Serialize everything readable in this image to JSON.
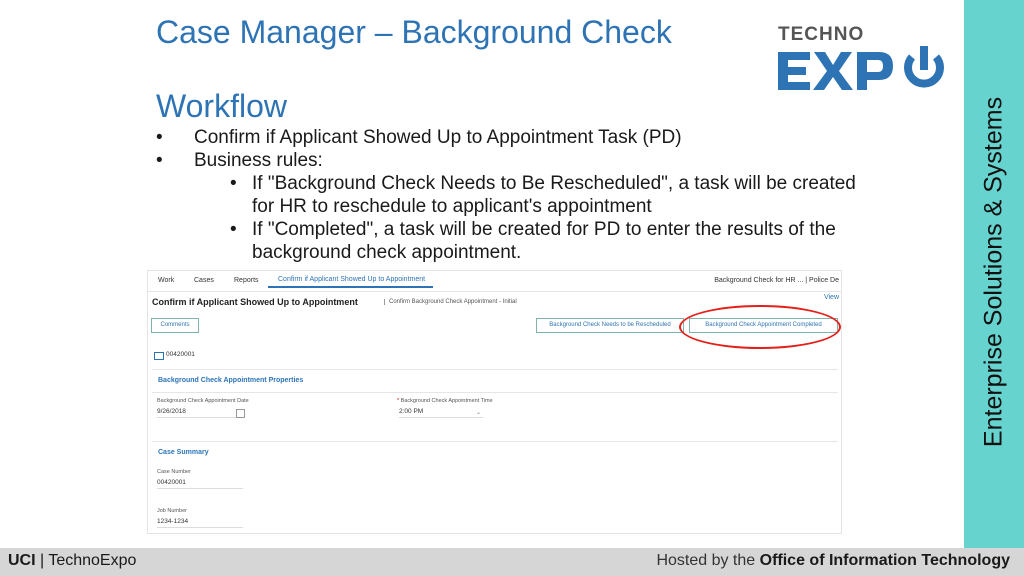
{
  "slide": {
    "title": "Case Manager – Background Check",
    "section_title": "Workflow",
    "bullet_1": "Confirm if Applicant Showed Up to Appointment Task (PD)",
    "bullet_2": "Business rules:",
    "sub_bullet_1": "If \"Background Check Needs to Be Rescheduled\", a task will be created for HR to reschedule to applicant's appointment",
    "sub_bullet_2": "If \"Completed\", a task will be created for PD to enter the results of the background check appointment.",
    "bullet_char": "•"
  },
  "logo": {
    "top": "TECHNO",
    "bottom": "EXPO"
  },
  "sidebar_text": "Enterprise Solutions & Systems",
  "footer": {
    "left_bold": "UCI",
    "left_sep": "|",
    "left_text": "TechnoExpo",
    "right_text": "Hosted by the",
    "right_bold": "Office of Information Technology"
  },
  "app": {
    "nav": {
      "work": "Work",
      "cases": "Cases",
      "reports": "Reports",
      "active_tab": "Confirm if Applicant Showed Up to Appointment",
      "right": "Background Check for HR ... | Police De"
    },
    "page_title": "Confirm if Applicant Showed Up to Appointment",
    "page_subtitle": "Confirm Background Check Appointment - Initial",
    "view_link": "View",
    "comments_button": "Comments",
    "reschedule_button": "Background Check Needs to be Rescheduled",
    "completed_button": "Background Check Appointment Completed",
    "case_id": "00420001",
    "properties_heading": "Background Check Appointment Properties",
    "date_label": "Background Check Appointment Date",
    "date_value": "9/26/2018",
    "time_label": "Background Check Appointment Time",
    "time_required_marker": "*",
    "time_value": "2:00 PM",
    "caret": "⌄",
    "summary_heading": "Case Summary",
    "case_number_label": "Case Number",
    "case_number_value": "00420001",
    "job_number_label": "Job Number",
    "job_number_value": "1234-1234"
  },
  "colors": {
    "title_blue": "#2e74b5",
    "sidebar_teal": "#66d3cf",
    "highlight_red": "#e3201b",
    "logo_blue": "#2e74b5"
  }
}
